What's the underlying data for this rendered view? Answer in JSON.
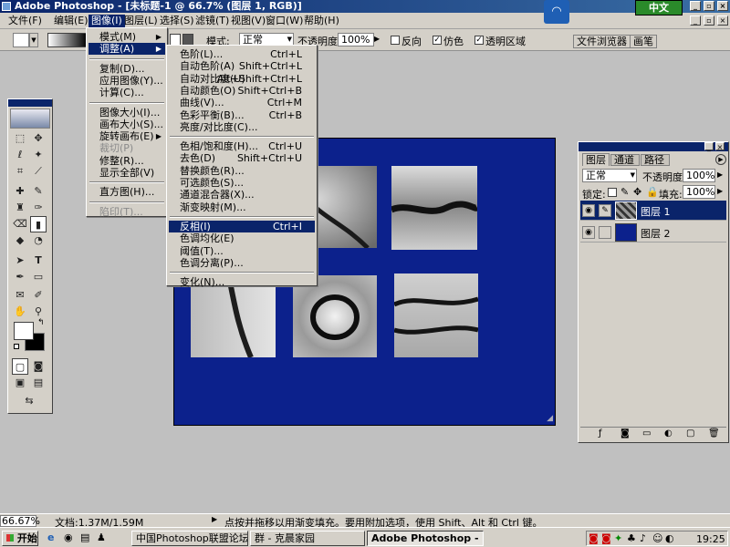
{
  "window": {
    "title": "Adobe Photoshop - [未标题-1 @ 66.7% (图层 1, RGB)]"
  },
  "menubar": {
    "items": [
      "文件(F)",
      "编辑(E)",
      "图像(I)",
      "图层(L)",
      "选择(S)",
      "滤镜(T)",
      "视图(V)",
      "窗口(W)",
      "帮助(H)"
    ],
    "active": "图像(I)"
  },
  "ime": {
    "label": "中文"
  },
  "options": {
    "mode_label": "模式:",
    "mode_value": "正常",
    "opacity_label": "不透明度:",
    "opacity_value": "100%",
    "reverse_label": "反向",
    "dither_label": "仿色",
    "transparency_label": "透明区域",
    "browser_tab": "文件浏览器",
    "brushes_tab": "画笔"
  },
  "image_menu": {
    "items": [
      {
        "label": "模式(M)",
        "submenu": true
      },
      {
        "label": "调整(A)",
        "submenu": true,
        "highlight": true
      },
      {
        "sep": true
      },
      {
        "label": "复制(D)..."
      },
      {
        "label": "应用图像(Y)..."
      },
      {
        "label": "计算(C)..."
      },
      {
        "sep": true
      },
      {
        "label": "图像大小(I)..."
      },
      {
        "label": "画布大小(S)..."
      },
      {
        "label": "旋转画布(E)",
        "submenu": true
      },
      {
        "label": "裁切(P)",
        "disabled": true
      },
      {
        "label": "修整(R)..."
      },
      {
        "label": "显示全部(V)"
      },
      {
        "sep": true
      },
      {
        "label": "直方图(H)..."
      },
      {
        "sep": true
      },
      {
        "label": "陷印(T)...",
        "disabled": true
      }
    ]
  },
  "adjust_menu": {
    "items": [
      {
        "label": "色阶(L)...",
        "shortcut": "Ctrl+L"
      },
      {
        "label": "自动色阶(A)",
        "shortcut": "Shift+Ctrl+L"
      },
      {
        "label": "自动对比度(U)",
        "shortcut": "Alt+Shift+Ctrl+L"
      },
      {
        "label": "自动颜色(O)",
        "shortcut": "Shift+Ctrl+B"
      },
      {
        "label": "曲线(V)...",
        "shortcut": "Ctrl+M"
      },
      {
        "label": "色彩平衡(B)...",
        "shortcut": "Ctrl+B"
      },
      {
        "label": "亮度/对比度(C)..."
      },
      {
        "sep": true
      },
      {
        "label": "色相/饱和度(H)...",
        "shortcut": "Ctrl+U"
      },
      {
        "label": "去色(D)",
        "shortcut": "Shift+Ctrl+U"
      },
      {
        "label": "替换颜色(R)..."
      },
      {
        "label": "可选颜色(S)..."
      },
      {
        "label": "通道混合器(X)..."
      },
      {
        "label": "渐变映射(M)..."
      },
      {
        "sep": true
      },
      {
        "label": "反相(I)",
        "shortcut": "Ctrl+I",
        "highlight": true
      },
      {
        "label": "色调均化(E)"
      },
      {
        "label": "阈值(T)..."
      },
      {
        "label": "色调分离(P)..."
      },
      {
        "sep": true
      },
      {
        "label": "变化(N)..."
      }
    ]
  },
  "layers_panel": {
    "tabs": [
      "图层",
      "通道",
      "路径"
    ],
    "blend_mode": "正常",
    "opacity_label": "不透明度:",
    "opacity_value": "100%",
    "lock_label": "锁定:",
    "fill_label": "填充:",
    "fill_value": "100%",
    "layers": [
      {
        "name": "图层 1",
        "selected": true
      },
      {
        "name": "图层 2",
        "selected": false
      }
    ]
  },
  "statusbar": {
    "zoom": "66.67%",
    "doc": "文档:1.37M/1.59M",
    "hint": "点按并拖移以用渐变填充。要用附加选项，使用 Shift、Alt 和 Ctrl 键。"
  },
  "taskbar": {
    "start": "开始",
    "tasks": [
      {
        "label": "中国Photoshop联盟论坛...",
        "pressed": false
      },
      {
        "label": "群 - 克晨家园",
        "pressed": false
      },
      {
        "label": "Adobe Photoshop - [未标...",
        "pressed": true
      }
    ],
    "clock": "19:25"
  },
  "colors": {
    "title_bar": "#0a246a",
    "canvas_bg": "#0c218c",
    "selection": "#0a246a"
  }
}
